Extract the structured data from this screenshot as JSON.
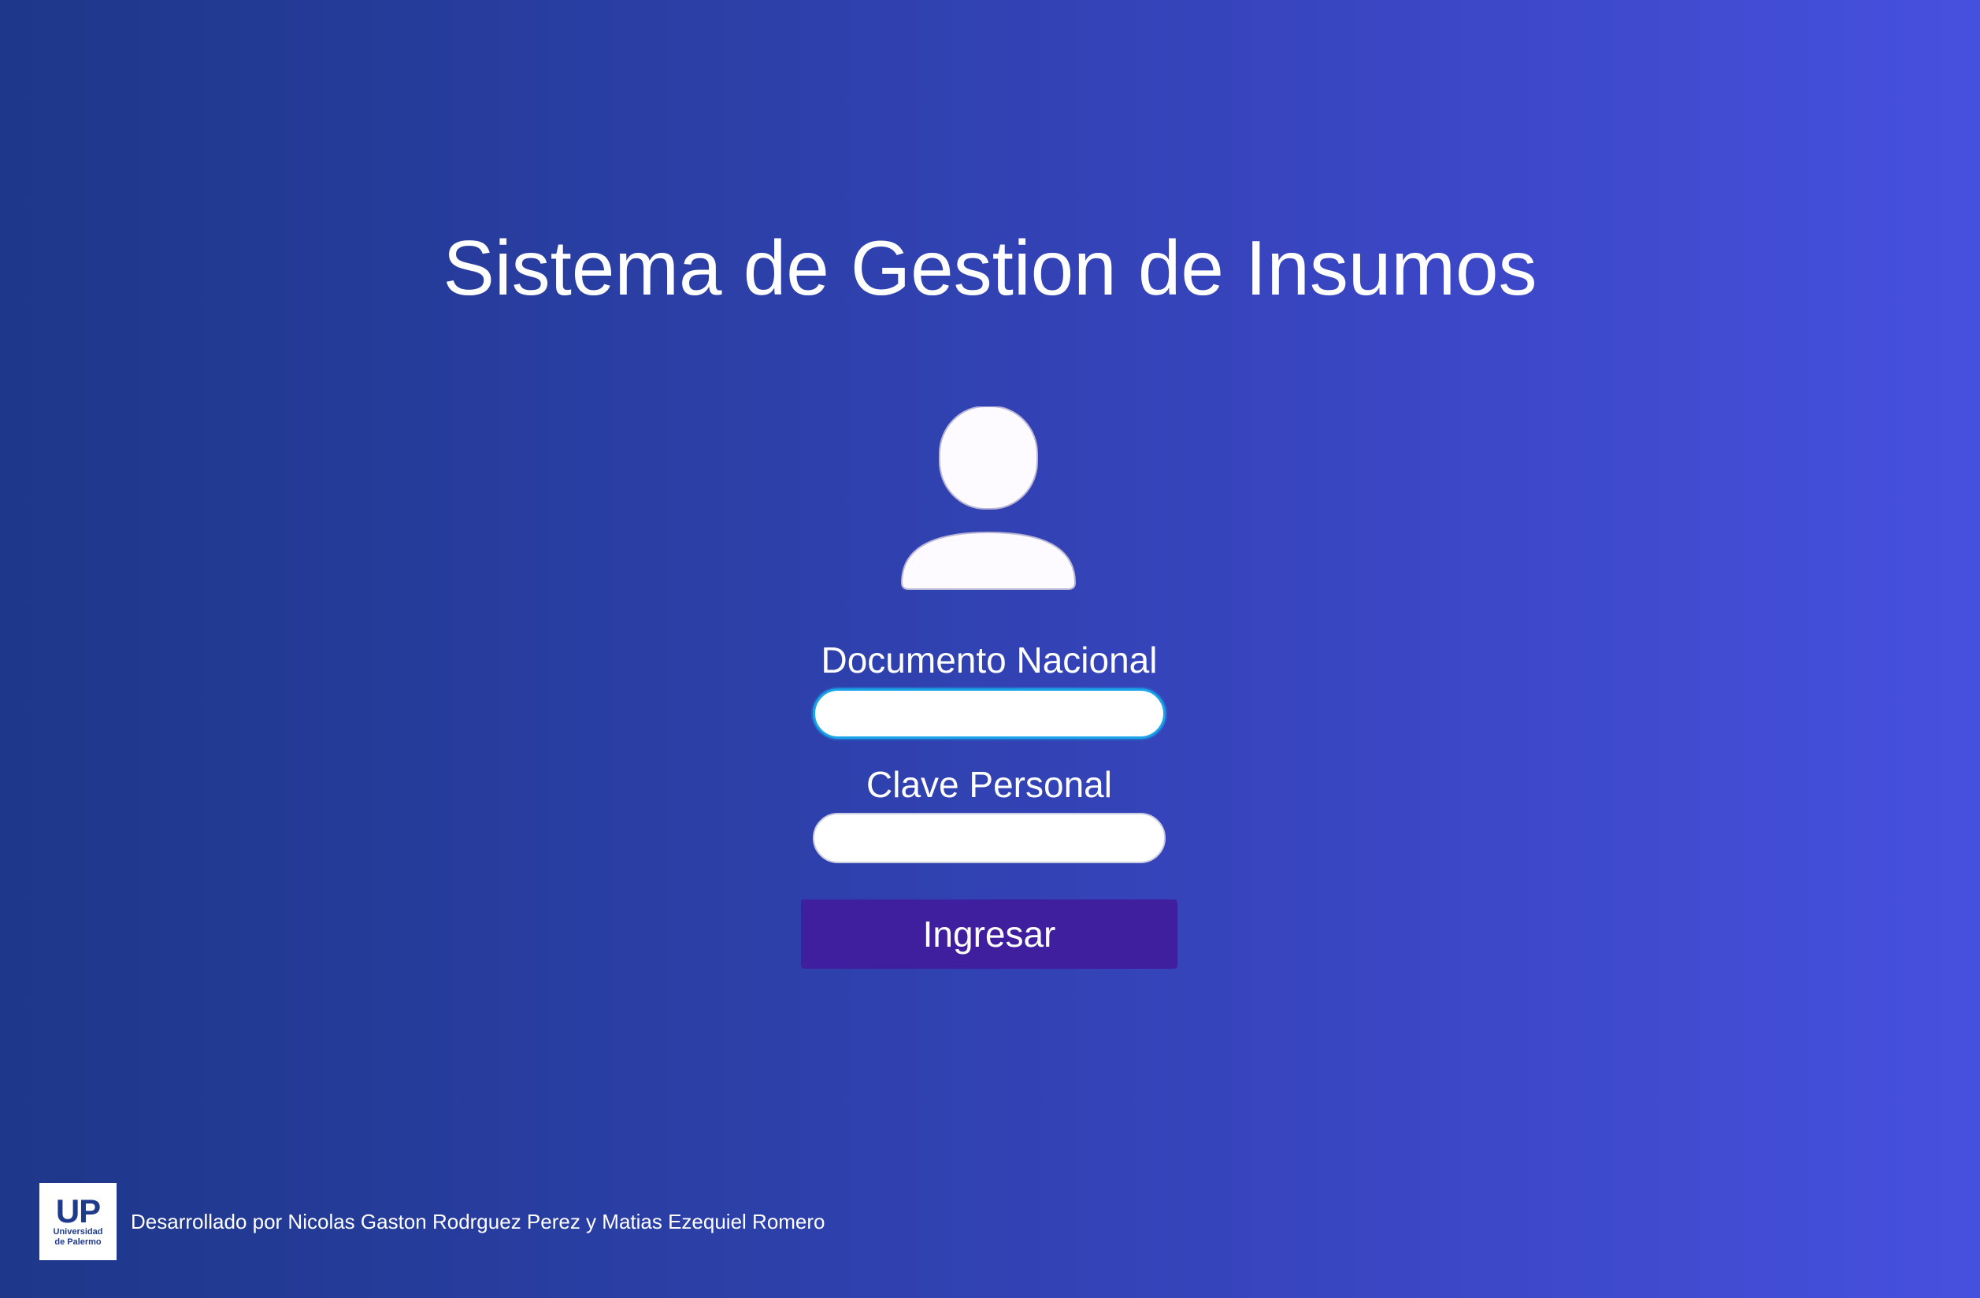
{
  "page": {
    "title": "Sistema de Gestion de Insumos"
  },
  "avatar": {
    "icon": "user-icon"
  },
  "form": {
    "document": {
      "label": "Documento Nacional",
      "value": "",
      "placeholder": "",
      "focused": true
    },
    "password": {
      "label": "Clave Personal",
      "value": "",
      "placeholder": ""
    },
    "submit_label": "Ingresar"
  },
  "footer": {
    "logo_main": "UP",
    "logo_line1": "Universidad",
    "logo_line2": "de Palermo",
    "credits": "Desarrollado por Nicolas Gaston Rodrguez Perez y Matias Ezequiel Romero"
  },
  "colors": {
    "background_start": "#1e3789",
    "background_end": "#4650de",
    "button": "#401f9f",
    "focus_ring": "#1aa3e8",
    "logo_text": "#1f3a8a"
  }
}
